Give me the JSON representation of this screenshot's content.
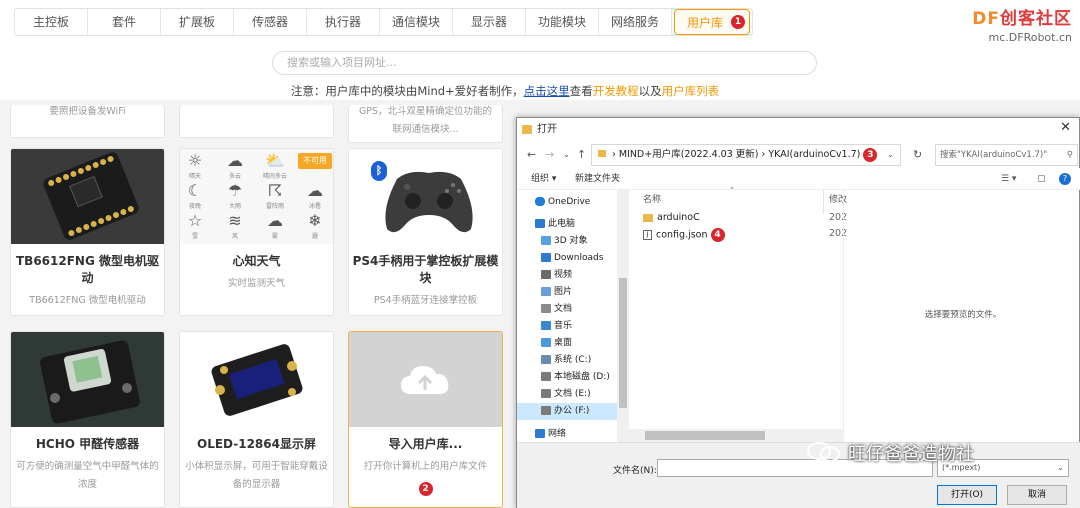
{
  "tabs": [
    {
      "label": "主控板"
    },
    {
      "label": "套件"
    },
    {
      "label": "扩展板"
    },
    {
      "label": "传感器"
    },
    {
      "label": "执行器"
    },
    {
      "label": "通信模块"
    },
    {
      "label": "显示器"
    },
    {
      "label": "功能模块"
    },
    {
      "label": "网络服务"
    },
    {
      "label": "用户库",
      "active": true
    }
  ],
  "markers": {
    "m1": "1",
    "m2": "2",
    "m3": "3",
    "m4": "4"
  },
  "brand": {
    "main_prefix": "DF",
    "main_rest": "创客社区",
    "url": "mc.DFRobot.cn"
  },
  "search": {
    "placeholder": "搜索或输入项目网址..."
  },
  "notice": {
    "prefix": "注意：用户库中的模块由Mind+爱好者制作，",
    "link": "点击这里",
    "mid": "查看",
    "tutorial": "开发教程",
    "and": "以及",
    "list": "用户库列表"
  },
  "stubs": {
    "s1": "要照把设备发WiFi",
    "s3a": "GPS，北斗双星精确定位功能的",
    "s3b": "联网通信模块..."
  },
  "cards": [
    {
      "title": "TB6612FNG 微型电机驱动",
      "desc": "TB6612FNG 微型电机驱动"
    },
    {
      "title": "心知天气",
      "desc": "实时监测天气",
      "tag": "不可用"
    },
    {
      "title": "PS4手柄用于掌控板扩展模块",
      "desc": "PS4手柄蓝牙连接掌控板"
    },
    {
      "title": "HCHO 甲醛传感器",
      "desc": "可方便的确测量空气中甲醛气体的浓度"
    },
    {
      "title": "OLED-12864显示屏",
      "desc": "小体积显示屏，可用于智能穿戴设备的显示器"
    },
    {
      "title": "导入用户库...",
      "desc": "打开你计算机上的用户库文件"
    }
  ],
  "weather_labels": [
    "晴天",
    "多云",
    "晴间多云",
    "阴",
    "夜晚",
    "大雨",
    "雷阵雨",
    "冰雹",
    "雪",
    "风",
    "雾",
    "霾"
  ],
  "dialog": {
    "title": "打开",
    "path": [
      "MIND+用户库(2022.4.03 更新)",
      "YKAI(arduinoCv1.7)"
    ],
    "search_placeholder": "搜索\"YKAI(arduinoCv1.7)\"",
    "organize": "组织 ▾",
    "new_folder": "新建文件夹",
    "nav_items": [
      {
        "label": "OneDrive",
        "icon": "cloud-icon",
        "color": "#1e7fd8"
      },
      {
        "label": "此电脑",
        "icon": "computer-icon",
        "color": "#2d7bd0"
      },
      {
        "label": "3D 对象",
        "icon": "cube-icon",
        "color": "#5aa0e0"
      },
      {
        "label": "Downloads",
        "icon": "download-icon",
        "color": "#2d7bd0"
      },
      {
        "label": "视频",
        "icon": "video-icon",
        "color": "#6a6a6a"
      },
      {
        "label": "图片",
        "icon": "image-icon",
        "color": "#6aa0d8"
      },
      {
        "label": "文档",
        "icon": "document-icon",
        "color": "#8a8a8a"
      },
      {
        "label": "音乐",
        "icon": "music-icon",
        "color": "#3a86d0"
      },
      {
        "label": "桌面",
        "icon": "desktop-icon",
        "color": "#4a9ae0"
      },
      {
        "label": "系统 (C:)",
        "icon": "drive-icon",
        "color": "#6a8ab0"
      },
      {
        "label": "本地磁盘 (D:)",
        "icon": "drive-icon",
        "color": "#7a7a7a"
      },
      {
        "label": "文档 (E:)",
        "icon": "drive-icon",
        "color": "#7a7a7a"
      },
      {
        "label": "办公 (F:)",
        "icon": "drive-icon",
        "color": "#7a7a7a"
      },
      {
        "label": "网络",
        "icon": "network-icon",
        "color": "#2d7bd0"
      }
    ],
    "col_name": "名称",
    "col_date": "修改",
    "files": [
      {
        "name": "arduinoC",
        "type": "folder",
        "date": "202"
      },
      {
        "name": "config.json",
        "type": "file",
        "date": "202"
      }
    ],
    "preview_text": "选择要预览的文件。",
    "filename_label": "文件名(N):",
    "filetype_value": "(*.mpext)",
    "open_label": "打开(O)",
    "cancel_label": "取消"
  },
  "watermark": "旺仔爸爸造物社"
}
